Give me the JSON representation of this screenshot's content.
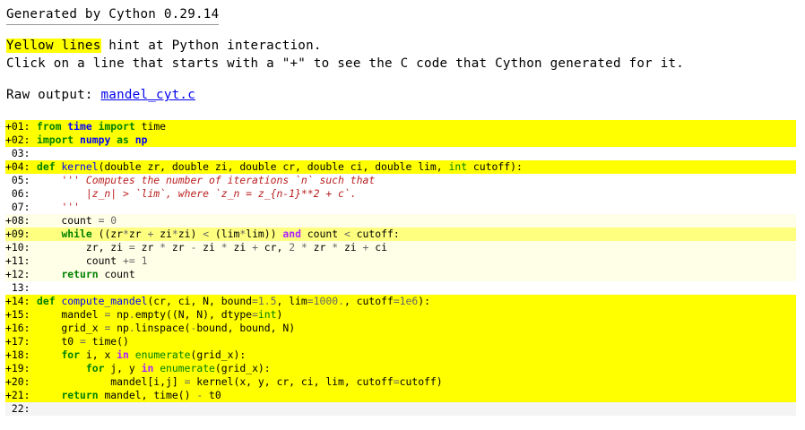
{
  "header": {
    "title": "Generated by Cython 0.29.14"
  },
  "intro": {
    "highlight": "Yellow lines",
    "rest": " hint at Python interaction.",
    "line2": "Click on a line that starts with a \"+\" to see the C code that Cython generated for it."
  },
  "raw_output": {
    "label": "Raw output: ",
    "link": "mandel_cyt.c"
  },
  "colors": {
    "hint_yellow": "#FFFF00"
  },
  "code_lines": [
    {
      "num": "+01:",
      "bg": "#FFFF00",
      "interactive": true,
      "tokens": [
        [
          "from",
          "kw"
        ],
        [
          " "
        ],
        [
          "time",
          "nmb"
        ],
        [
          " "
        ],
        [
          "import",
          "kw"
        ],
        [
          " time"
        ]
      ]
    },
    {
      "num": "+02:",
      "bg": "#FFFF00",
      "interactive": true,
      "tokens": [
        [
          "import",
          "kw"
        ],
        [
          " "
        ],
        [
          "numpy",
          "nmb"
        ],
        [
          " "
        ],
        [
          "as",
          "kw"
        ],
        [
          " "
        ],
        [
          "np",
          "nmb"
        ]
      ]
    },
    {
      "num": " 03:",
      "bg": "#FFFFFF",
      "interactive": false,
      "tokens": []
    },
    {
      "num": "+04:",
      "bg": "#FFFF00",
      "interactive": true,
      "tokens": [
        [
          "def",
          "kw"
        ],
        [
          " "
        ],
        [
          "kernel",
          "nm"
        ],
        [
          "(double zr, double zi, double cr, double ci, double lim, "
        ],
        [
          "int",
          "bi"
        ],
        [
          " cutoff):"
        ]
      ]
    },
    {
      "num": " 05:",
      "bg": "#FFFFFF",
      "interactive": false,
      "tokens": [
        [
          "    "
        ],
        [
          "''' Computes the number of iterations `n` such that",
          "str"
        ]
      ]
    },
    {
      "num": " 06:",
      "bg": "#FFFFFF",
      "interactive": false,
      "tokens": [
        [
          "        |z_n| > `lim`, where `z_n = z_{n-1}**2 + c`.",
          "str"
        ]
      ]
    },
    {
      "num": " 07:",
      "bg": "#FFFFFF",
      "interactive": false,
      "tokens": [
        [
          "    "
        ],
        [
          "'''",
          "str"
        ]
      ]
    },
    {
      "num": "+08:",
      "bg": "#FFFFE8",
      "interactive": true,
      "tokens": [
        [
          "    count "
        ],
        [
          "=",
          "op"
        ],
        [
          " "
        ],
        [
          "0",
          "num"
        ]
      ]
    },
    {
      "num": "+09:",
      "bg": "#FFFF7F",
      "interactive": true,
      "tokens": [
        [
          "    "
        ],
        [
          "while",
          "kw"
        ],
        [
          " ((zr"
        ],
        [
          "*",
          "op"
        ],
        [
          "zr "
        ],
        [
          "+",
          "op"
        ],
        [
          " zi"
        ],
        [
          "*",
          "op"
        ],
        [
          "zi) "
        ],
        [
          "<",
          "op"
        ],
        [
          " (lim"
        ],
        [
          "*",
          "op"
        ],
        [
          "lim)) "
        ],
        [
          "and",
          "kwp"
        ],
        [
          " count "
        ],
        [
          "<",
          "op"
        ],
        [
          " cutoff:"
        ]
      ]
    },
    {
      "num": "+10:",
      "bg": "#FFFFE8",
      "interactive": true,
      "tokens": [
        [
          "        zr, zi "
        ],
        [
          "=",
          "op"
        ],
        [
          " zr "
        ],
        [
          "*",
          "op"
        ],
        [
          " zr "
        ],
        [
          "-",
          "op"
        ],
        [
          " zi "
        ],
        [
          "*",
          "op"
        ],
        [
          " zi "
        ],
        [
          "+",
          "op"
        ],
        [
          " cr, "
        ],
        [
          "2",
          "num"
        ],
        [
          " "
        ],
        [
          "*",
          "op"
        ],
        [
          " zr "
        ],
        [
          "*",
          "op"
        ],
        [
          " zi "
        ],
        [
          "+",
          "op"
        ],
        [
          " ci"
        ]
      ]
    },
    {
      "num": "+11:",
      "bg": "#FFFFE8",
      "interactive": true,
      "tokens": [
        [
          "        count "
        ],
        [
          "+=",
          "op"
        ],
        [
          " "
        ],
        [
          "1",
          "num"
        ]
      ]
    },
    {
      "num": "+12:",
      "bg": "#FFFFE8",
      "interactive": true,
      "tokens": [
        [
          "    "
        ],
        [
          "return",
          "kw"
        ],
        [
          " count"
        ]
      ]
    },
    {
      "num": " 13:",
      "bg": "#FFFFFF",
      "interactive": false,
      "tokens": []
    },
    {
      "num": "+14:",
      "bg": "#FFFF00",
      "interactive": true,
      "tokens": [
        [
          "def",
          "kw"
        ],
        [
          " "
        ],
        [
          "compute_mandel",
          "nm"
        ],
        [
          "(cr, ci, N, bound"
        ],
        [
          "=",
          "op"
        ],
        [
          "1.5",
          "num"
        ],
        [
          ", lim"
        ],
        [
          "=",
          "op"
        ],
        [
          "1000.",
          "num"
        ],
        [
          ", cutoff"
        ],
        [
          "=",
          "op"
        ],
        [
          "1e6",
          "num"
        ],
        [
          "):"
        ]
      ]
    },
    {
      "num": "+15:",
      "bg": "#FFFF00",
      "interactive": true,
      "tokens": [
        [
          "    mandel "
        ],
        [
          "=",
          "op"
        ],
        [
          " np"
        ],
        [
          ".",
          "op"
        ],
        [
          "empty((N, N), dtype"
        ],
        [
          "=",
          "op"
        ],
        [
          "int",
          "bi"
        ],
        [
          ")"
        ]
      ]
    },
    {
      "num": "+16:",
      "bg": "#FFFF00",
      "interactive": true,
      "tokens": [
        [
          "    grid_x "
        ],
        [
          "=",
          "op"
        ],
        [
          " np"
        ],
        [
          ".",
          "op"
        ],
        [
          "linspace("
        ],
        [
          "-",
          "op"
        ],
        [
          "bound, bound, N)"
        ]
      ]
    },
    {
      "num": "+17:",
      "bg": "#FFFF00",
      "interactive": true,
      "tokens": [
        [
          "    t0 "
        ],
        [
          "=",
          "op"
        ],
        [
          " time()"
        ]
      ]
    },
    {
      "num": "+18:",
      "bg": "#FFFF00",
      "interactive": true,
      "tokens": [
        [
          "    "
        ],
        [
          "for",
          "kw"
        ],
        [
          " i, x "
        ],
        [
          "in",
          "kwp"
        ],
        [
          " "
        ],
        [
          "enumerate",
          "bi"
        ],
        [
          "(grid_x):"
        ]
      ]
    },
    {
      "num": "+19:",
      "bg": "#FFFF00",
      "interactive": true,
      "tokens": [
        [
          "        "
        ],
        [
          "for",
          "kw"
        ],
        [
          " j, y "
        ],
        [
          "in",
          "kwp"
        ],
        [
          " "
        ],
        [
          "enumerate",
          "bi"
        ],
        [
          "(grid_x):"
        ]
      ]
    },
    {
      "num": "+20:",
      "bg": "#FFFF00",
      "interactive": true,
      "tokens": [
        [
          "            mandel[i,j] "
        ],
        [
          "=",
          "op"
        ],
        [
          " kernel(x, y, cr, ci, lim, cutoff"
        ],
        [
          "=",
          "op"
        ],
        [
          "cutoff)"
        ]
      ]
    },
    {
      "num": "+21:",
      "bg": "#FFFF00",
      "interactive": true,
      "tokens": [
        [
          "    "
        ],
        [
          "return",
          "kw"
        ],
        [
          " mandel, time() "
        ],
        [
          "-",
          "op"
        ],
        [
          " t0"
        ]
      ]
    },
    {
      "num": " 22:",
      "bg": "#F4F4F4",
      "interactive": false,
      "tokens": []
    }
  ]
}
